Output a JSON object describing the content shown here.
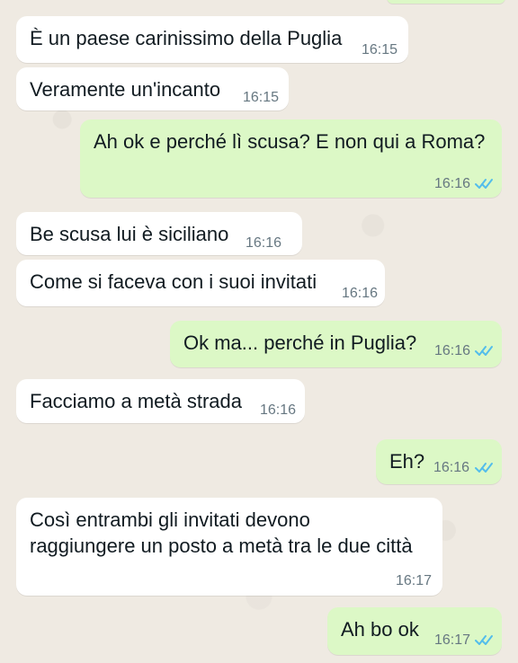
{
  "messages": [
    {
      "direction": "incoming",
      "text": "È un paese carinissimo della Puglia",
      "time": "16:15"
    },
    {
      "direction": "incoming",
      "text": "Veramente un'incanto",
      "time": "16:15"
    },
    {
      "direction": "outgoing",
      "text": "Ah ok e perché lì scusa? E non qui a Roma?",
      "time": "16:16",
      "status_icon": "double-check-read-icon"
    },
    {
      "direction": "incoming",
      "text": "Be scusa lui è siciliano",
      "time": "16:16"
    },
    {
      "direction": "incoming",
      "text": "Come si faceva con i suoi invitati",
      "time": "16:16"
    },
    {
      "direction": "outgoing",
      "text": "Ok ma... perché in Puglia?",
      "time": "16:16",
      "status_icon": "double-check-read-icon"
    },
    {
      "direction": "incoming",
      "text": "Facciamo a metà strada",
      "time": "16:16"
    },
    {
      "direction": "outgoing",
      "text": "Eh?",
      "time": "16:16",
      "status_icon": "double-check-read-icon"
    },
    {
      "direction": "incoming",
      "text": "Così entrambi gli invitati devono\nraggiungere un posto a metà tra le due città",
      "time": "16:17"
    },
    {
      "direction": "outgoing",
      "text": "Ah bo ok",
      "time": "16:17",
      "status_icon": "double-check-read-icon"
    }
  ],
  "colors": {
    "background": "#efeae2",
    "incoming_bubble": "#ffffff",
    "outgoing_bubble": "#dcf8c6",
    "timestamp": "#667781",
    "read_receipt": "#53bdeb"
  }
}
